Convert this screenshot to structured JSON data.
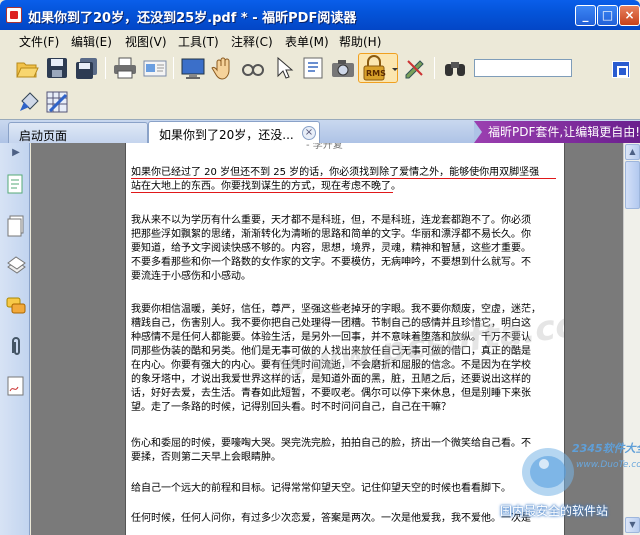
{
  "window": {
    "title": "如果你到了20岁，还没到25岁.pdf * - 福昕PDF阅读器",
    "min": "_",
    "max": "□",
    "close": "×"
  },
  "menu": [
    {
      "label": "文件(F)"
    },
    {
      "label": "编辑(E)"
    },
    {
      "label": "视图(V)"
    },
    {
      "label": "工具(T)"
    },
    {
      "label": "注释(C)"
    },
    {
      "label": "表单(M)"
    },
    {
      "label": "帮助(H)"
    }
  ],
  "toolbar": {
    "rms_label": "RMS"
  },
  "tabs": {
    "home": "启动页面",
    "doc": "如果你到了20岁，还没...",
    "close": "×",
    "promo": "福昕PDF套件,让编辑更自由!"
  },
  "document": {
    "header_fragment": "- 李开复",
    "annotated": [
      "如果你已经过了 20 岁但还不到 25 岁的话，你必须找到除了爱情之外，能够使你用双脚坚强",
      "站在大地上的东西。你要找到谋生的方式，现在考虑不晚了。"
    ],
    "p1": [
      "我从来不以为学历有什么重要，天才都不是科班，但，不是科班，连龙套都跑不了。你必须",
      "把那些浮如飘絮的思绪，渐渐转化为清晰的思路和简单的文字。华丽和漂浮都不易长久。你",
      "要知道，给予文字阅读快感不够的。内容，思想，境界，灵魂，精神和智慧，这些才重要。",
      "不要多看那些和你一个路数的女作家的文字。不要模仿，无病呻吟，不要想到什么就写。不",
      "要流连于小感伤和小感动。"
    ],
    "p2": [
      "我要你相信温暖，美好，信任，尊严，坚强这些老掉牙的字眼。我不要你颓废，空虚，迷茫，",
      "糟践自己，伤害别人。我不要你把自己处理得一团糟。节制自己的感情并且珍惜它，明白这",
      "种感情不是任何人都能要。体验生活，是另外一回事，并不意味着堕落和放纵。千万不要认",
      "同那些伪装的酷和另类。他们是无事可做的人找出来放任自己无事可做的借口，真正的酷是",
      "在内心。你要有强大的内心。要有任凭时间流逝，不会磨折和屈服的信念。不是因为在学校",
      "的象牙塔中，才说出我爱世界这样的话，是知道外面的黑，脏，丑陋之后，还要说出这样的",
      "话，好好去爱，去生活。青春如此短暂，不要叹老。偶尔可以停下来休息，但是别睡下来张",
      "望。走了一条路的时候，记得别回头看。时不时问问自己，自己在干嘛？"
    ],
    "p3": [
      "伤心和委屈的时候，要嚎啕大哭。哭完洗完脸，拍拍自己的脸，挤出一个微笑给自己看。不",
      "要揉，否则第二天早上会眼睛肿。"
    ],
    "p4": [
      "给自己一个远大的前程和目标。记得常常仰望天空。记住仰望天空的时候也看看脚下。"
    ],
    "p5": [
      "任何时候，任何人问你，有过多少次恋爱，答案是两次。一次是他爱我，我不爱他。一次是"
    ],
    "watermark": "www.pcsofta.com"
  },
  "logo": {
    "brand": "2345软件大全",
    "url": "www.DuoTe.com",
    "slogan": "国内最安全的软件站"
  },
  "colors": {
    "titlebar": "#0453D8",
    "annotation": "#e0181a",
    "promo": "#7a2a9a"
  }
}
